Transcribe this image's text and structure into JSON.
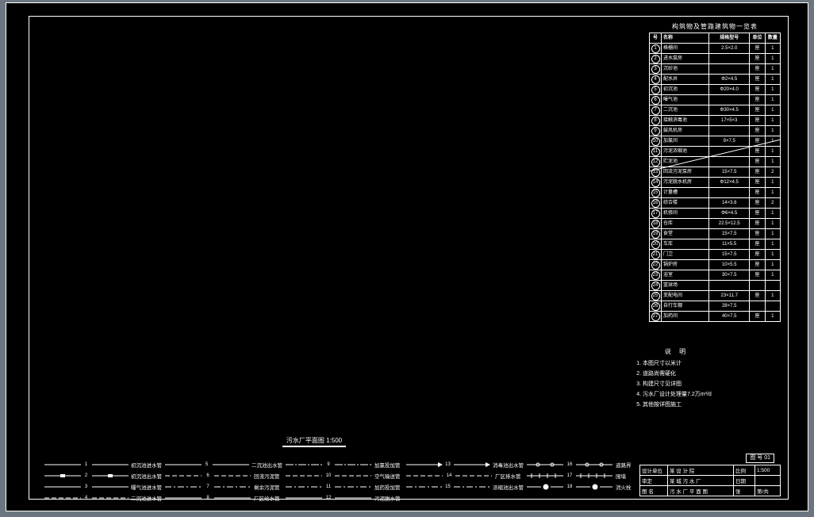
{
  "domain": "Diagram",
  "table": {
    "title": "构筑物及管路建筑物一览表",
    "headers": {
      "num": "号",
      "name": "名称",
      "spec": "规格型号",
      "unit": "单位",
      "qty": "数量"
    },
    "rows": [
      {
        "n": "1",
        "name": "格栅间",
        "spec": "2.5×2.0",
        "unit": "座",
        "qty": "1"
      },
      {
        "n": "2",
        "name": "进水泵房",
        "spec": "",
        "unit": "座",
        "qty": "1"
      },
      {
        "n": "3",
        "name": "沉砂池",
        "spec": "",
        "unit": "座",
        "qty": "1"
      },
      {
        "n": "4",
        "name": "配水井",
        "spec": "Φ2×4.5",
        "unit": "座",
        "qty": "1"
      },
      {
        "n": "5",
        "name": "初沉池",
        "spec": "Φ20×4.0",
        "unit": "座",
        "qty": "1"
      },
      {
        "n": "6",
        "name": "曝气池",
        "spec": "",
        "unit": "座",
        "qty": "1"
      },
      {
        "n": "7",
        "name": "二沉池",
        "spec": "Φ30×4.5",
        "unit": "座",
        "qty": "1"
      },
      {
        "n": "8",
        "name": "接触消毒池",
        "spec": "17×5×3",
        "unit": "座",
        "qty": "1"
      },
      {
        "n": "9",
        "name": "鼓风机房",
        "spec": "",
        "unit": "座",
        "qty": "1"
      },
      {
        "n": "10",
        "name": "加氯间",
        "spec": "9×7.5",
        "unit": "座",
        "qty": "1"
      },
      {
        "n": "11",
        "name": "污泥浓缩池",
        "spec": "",
        "unit": "座",
        "qty": "1"
      },
      {
        "n": "12",
        "name": "贮泥池",
        "spec": "",
        "unit": "座",
        "qty": "1"
      },
      {
        "n": "13",
        "name": "回流污泥泵房",
        "spec": "15×7.5",
        "unit": "座",
        "qty": "2"
      },
      {
        "n": "14",
        "name": "污泥脱水机房",
        "spec": "Φ12×4.5",
        "unit": "座",
        "qty": "1"
      },
      {
        "n": "15",
        "name": "计量槽",
        "spec": "",
        "unit": "座",
        "qty": "1"
      },
      {
        "n": "16",
        "name": "综合楼",
        "spec": "14×3.6",
        "unit": "座",
        "qty": "2"
      },
      {
        "n": "17",
        "name": "机修间",
        "spec": "Φ6×4.5",
        "unit": "座",
        "qty": "1"
      },
      {
        "n": "18",
        "name": "仓库",
        "spec": "22.5×12.5",
        "unit": "座",
        "qty": "1"
      },
      {
        "n": "19",
        "name": "食堂",
        "spec": "15×7.5",
        "unit": "座",
        "qty": "1"
      },
      {
        "n": "20",
        "name": "车库",
        "spec": "11×5.5",
        "unit": "座",
        "qty": "1"
      },
      {
        "n": "21",
        "name": "门卫",
        "spec": "15×7.5",
        "unit": "座",
        "qty": "1"
      },
      {
        "n": "22",
        "name": "锅炉房",
        "spec": "10×5.5",
        "unit": "座",
        "qty": "1"
      },
      {
        "n": "23",
        "name": "浴室",
        "spec": "30×7.5",
        "unit": "座",
        "qty": "1"
      },
      {
        "n": "24",
        "name": "篮球场",
        "spec": "",
        "unit": "",
        "qty": ""
      },
      {
        "n": "25",
        "name": "变配电间",
        "spec": "23×11.7",
        "unit": "座",
        "qty": "1"
      },
      {
        "n": "26",
        "name": "自行车棚",
        "spec": "28×7.5",
        "unit": "",
        "qty": ""
      },
      {
        "n": "27",
        "name": "加药间",
        "spec": "40×7.5",
        "unit": "座",
        "qty": "1"
      }
    ]
  },
  "notes": {
    "title": "说  明",
    "items": [
      "本图尺寸以米计",
      "道路尚需硬化",
      "构建尺寸见详图",
      "污水厂设计处理量7.2万m³/d",
      "其他按详图施工"
    ]
  },
  "plan_title": "污水厂平面图 1:500",
  "legend": {
    "items": [
      {
        "n": "1",
        "label": "初沉池进水管",
        "style": "solid"
      },
      {
        "n": "2",
        "label": "初沉池出水管",
        "style": "solid-bar"
      },
      {
        "n": "3",
        "label": "曝气池进水管",
        "style": "solid"
      },
      {
        "n": "4",
        "label": "二沉池进水管",
        "style": "dash"
      },
      {
        "n": "5",
        "label": "二沉池出水管",
        "style": "solid"
      },
      {
        "n": "6",
        "label": "回流污泥管",
        "style": "dash"
      },
      {
        "n": "7",
        "label": "剩余污泥管",
        "style": "dashdot"
      },
      {
        "n": "8",
        "label": "厂区给水管",
        "style": "solid"
      },
      {
        "n": "9",
        "label": "加氯投加管",
        "style": "chain"
      },
      {
        "n": "10",
        "label": "空气输送管",
        "style": "dash"
      },
      {
        "n": "11",
        "label": "加药投加管",
        "style": "dashdot"
      },
      {
        "n": "12",
        "label": "污泥脱水管",
        "style": "solid"
      },
      {
        "n": "13",
        "label": "消毒池出水管",
        "style": "solid-arrow"
      },
      {
        "n": "14",
        "label": "厂区排水管",
        "style": "dash"
      },
      {
        "n": "15",
        "label": "浓缩池出水管",
        "style": "dashdot"
      },
      {
        "n": "16",
        "label": "道路界",
        "style": "dot-o"
      },
      {
        "n": "17",
        "label": "围墙",
        "style": "wall"
      },
      {
        "n": "18",
        "label": "消火栓",
        "style": "hydrant"
      }
    ]
  },
  "titleblock": {
    "sheet": "图 号 01",
    "row1": {
      "a": "设计单位",
      "b": "某 设 计 院",
      "c": "比例",
      "d": "1:500"
    },
    "row2": {
      "a": "审定",
      "b": "某 城 污 水 厂",
      "c": "日期",
      "d": ""
    },
    "row3": {
      "a": "图",
      "b": "名",
      "c": "污 水 厂 平 面 图",
      "d": "张",
      "e": "第",
      "f": "共"
    }
  }
}
